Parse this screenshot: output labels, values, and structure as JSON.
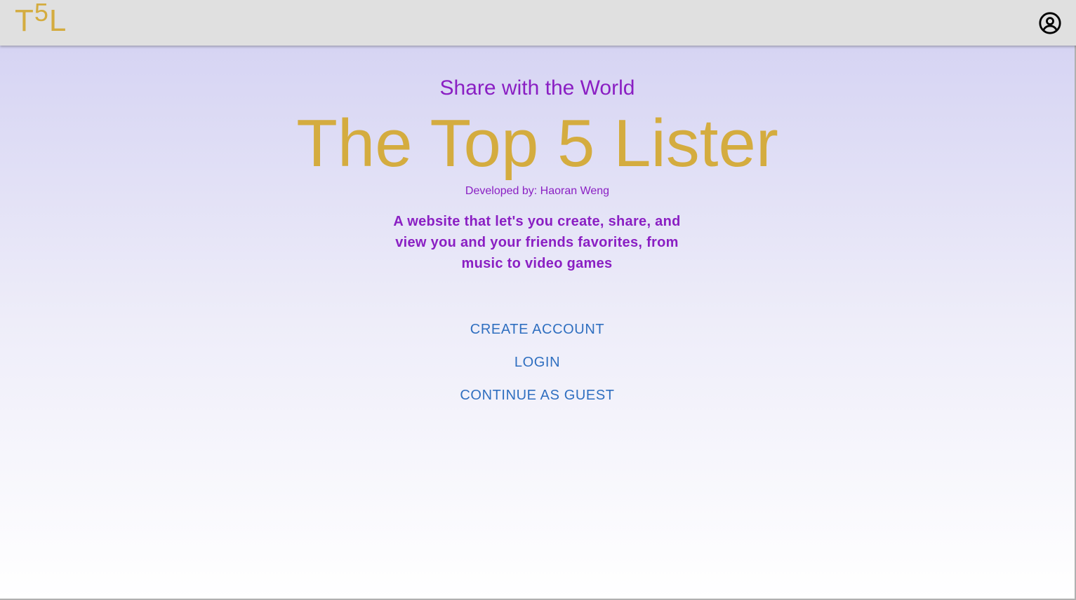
{
  "app": {
    "logo": {
      "left": "T",
      "sup": "5",
      "right": "L"
    },
    "account_icon": "account-circle-icon"
  },
  "hero": {
    "subtitle": "Share with the World",
    "title": "The Top 5 Lister",
    "developer": "Developed by: Haoran Weng",
    "description": "A website that let's you create, share, and view you and your friends favorites, from music to video games"
  },
  "actions": {
    "create_account": "CREATE ACCOUNT",
    "login": "LOGIN",
    "guest": "CONTINUE AS GUEST"
  },
  "colors": {
    "gold": "#d4ac3f",
    "purple": "#8a1fc3",
    "link_blue": "#2f6fc0",
    "appbar": "#e0e0e0"
  }
}
